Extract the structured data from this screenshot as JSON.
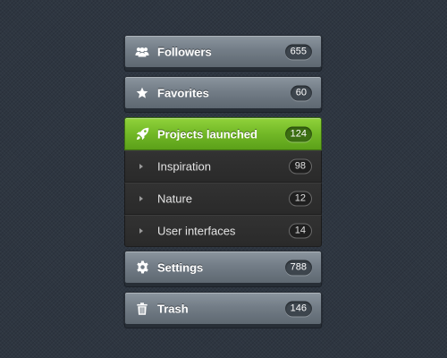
{
  "colors": {
    "background": "#2e3641",
    "item_gray": "#737d87",
    "active_green": "#72b827",
    "submenu_dark": "#2e2e2e"
  },
  "menu": {
    "items": [
      {
        "label": "Followers",
        "count": "655",
        "icon": "users-icon"
      },
      {
        "label": "Favorites",
        "count": "60",
        "icon": "star-icon"
      },
      {
        "label": "Projects launched",
        "count": "124",
        "icon": "rocket-icon",
        "active": true
      },
      {
        "label": "Settings",
        "count": "788",
        "icon": "gear-icon"
      },
      {
        "label": "Trash",
        "count": "146",
        "icon": "trash-icon"
      }
    ],
    "subitems": [
      {
        "label": "Inspiration",
        "count": "98",
        "icon": "triangle-right-icon"
      },
      {
        "label": "Nature",
        "count": "12",
        "icon": "triangle-right-icon"
      },
      {
        "label": "User interfaces",
        "count": "14",
        "icon": "triangle-right-icon"
      }
    ]
  }
}
